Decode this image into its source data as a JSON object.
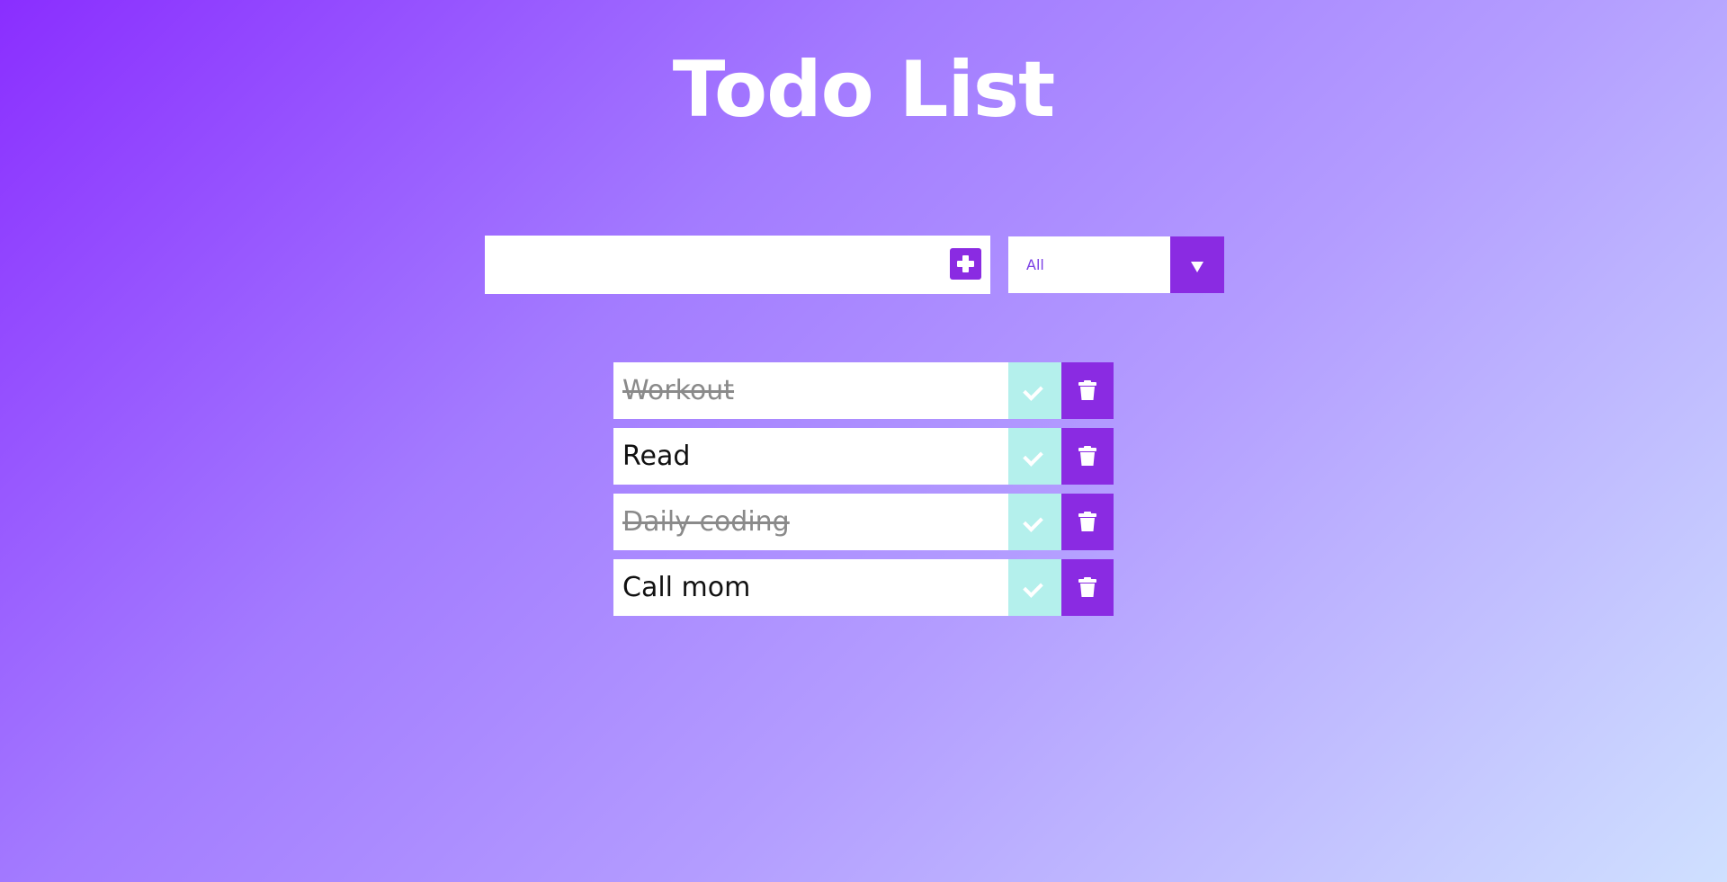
{
  "app": {
    "title": "Todo List"
  },
  "input": {
    "value": "",
    "placeholder": "",
    "add_icon": "plus-square-icon"
  },
  "filter": {
    "selected": "All",
    "icon": "dropdown-arrow-icon"
  },
  "todos": [
    {
      "text": "Workout",
      "completed": true
    },
    {
      "text": "Read",
      "completed": false
    },
    {
      "text": "Daily coding",
      "completed": true
    },
    {
      "text": "Call mom",
      "completed": false
    }
  ],
  "colors": {
    "accent": "#8a2be2",
    "check_bg": "#b4f0ec",
    "gradient_start": "#8a2eff",
    "gradient_end": "#cfe0ff"
  }
}
